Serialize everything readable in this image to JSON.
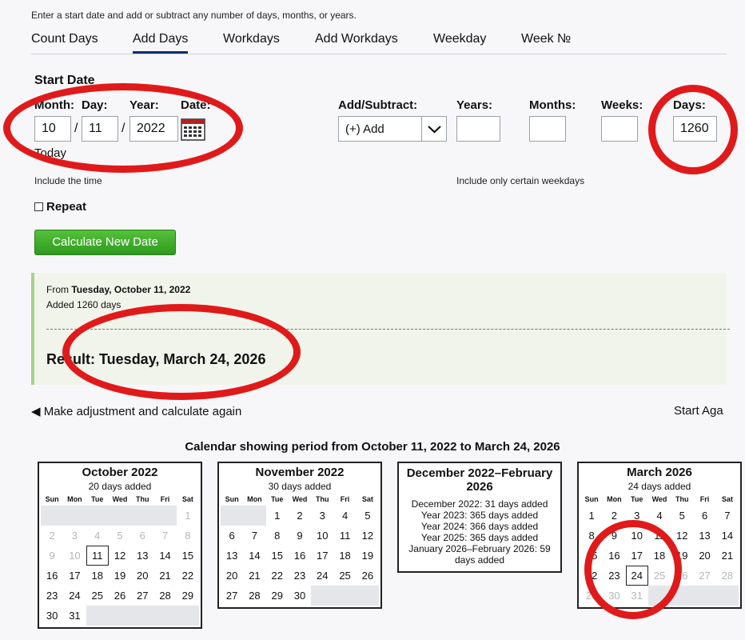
{
  "intro": "Enter a start date and add or subtract any number of days, months, or years.",
  "tabs": [
    "Count Days",
    "Add Days",
    "Workdays",
    "Add Workdays",
    "Weekday",
    "Week №"
  ],
  "start": {
    "title": "Start Date",
    "month_label": "Month:",
    "day_label": "Day:",
    "year_label": "Year:",
    "date_label": "Date:",
    "month": "10",
    "day": "11",
    "year": "2022",
    "sep": "/",
    "today": "Today",
    "include_time": "Include the time"
  },
  "add": {
    "label": "Add/Subtract:",
    "select_value": "(+) Add",
    "years_label": "Years:",
    "months_label": "Months:",
    "weeks_label": "Weeks:",
    "days_label": "Days:",
    "years": "",
    "months": "",
    "weeks": "",
    "days": "1260",
    "weekdays_note": "Include only certain weekdays"
  },
  "repeat": "Repeat",
  "calc_button": "Calculate New Date",
  "result": {
    "from_prefix": "From ",
    "from_date": "Tuesday, October 11, 2022",
    "added": "Added 1260 days",
    "result_prefix": "Result: ",
    "result_date": "Tuesday, March 24, 2026"
  },
  "links": {
    "adjust": "◀ Make adjustment and calculate again",
    "start_again": "Start Aga"
  },
  "calendar": {
    "title": "Calendar showing period from October 11, 2022 to March 24, 2026",
    "dow": [
      "Sun",
      "Mon",
      "Tue",
      "Wed",
      "Thu",
      "Fri",
      "Sat"
    ],
    "months": [
      {
        "name": "October 2022",
        "added": "20 days added",
        "cells": [
          "",
          "",
          "",
          "",
          "",
          "",
          "1m",
          "2m",
          "3m",
          "4m",
          "5m",
          "6m",
          "7m",
          "8m",
          "9m",
          "10m",
          "11h",
          "12",
          "13",
          "14",
          "15",
          "16",
          "17",
          "18",
          "19",
          "20",
          "21",
          "22",
          "23",
          "24",
          "25",
          "26",
          "27",
          "28",
          "29",
          "30",
          "31",
          "",
          "",
          "",
          "",
          ""
        ]
      },
      {
        "name": "November 2022",
        "added": "30 days added",
        "cells": [
          "",
          "",
          "1",
          "2",
          "3",
          "4",
          "5",
          "6",
          "7",
          "8",
          "9",
          "10",
          "11",
          "12",
          "13",
          "14",
          "15",
          "16",
          "17",
          "18",
          "19",
          "20",
          "21",
          "22",
          "23",
          "24",
          "25",
          "26",
          "27",
          "28",
          "29",
          "30",
          "",
          "",
          ""
        ]
      },
      {
        "name": "March 2026",
        "added": "24 days added",
        "cells": [
          "1",
          "2",
          "3",
          "4",
          "5",
          "6",
          "7",
          "8",
          "9",
          "10",
          "11",
          "12",
          "13",
          "14",
          "15",
          "16",
          "17",
          "18",
          "19",
          "20",
          "21",
          "22",
          "23",
          "24h",
          "25m",
          "26m",
          "27m",
          "28m",
          "29m",
          "30m",
          "31m",
          "",
          "",
          "",
          ""
        ]
      }
    ],
    "summary": {
      "name": "December 2022–February 2026",
      "lines": [
        "December 2022: 31 days added",
        "Year 2023: 365 days added",
        "Year 2024: 366 days added",
        "Year 2025: 365 days added",
        "January 2026–February 2026: 59 days added"
      ]
    }
  },
  "colors": {
    "accent": "#0b2f6b",
    "button": "#3aa626",
    "annotation": "#e01a1a"
  }
}
